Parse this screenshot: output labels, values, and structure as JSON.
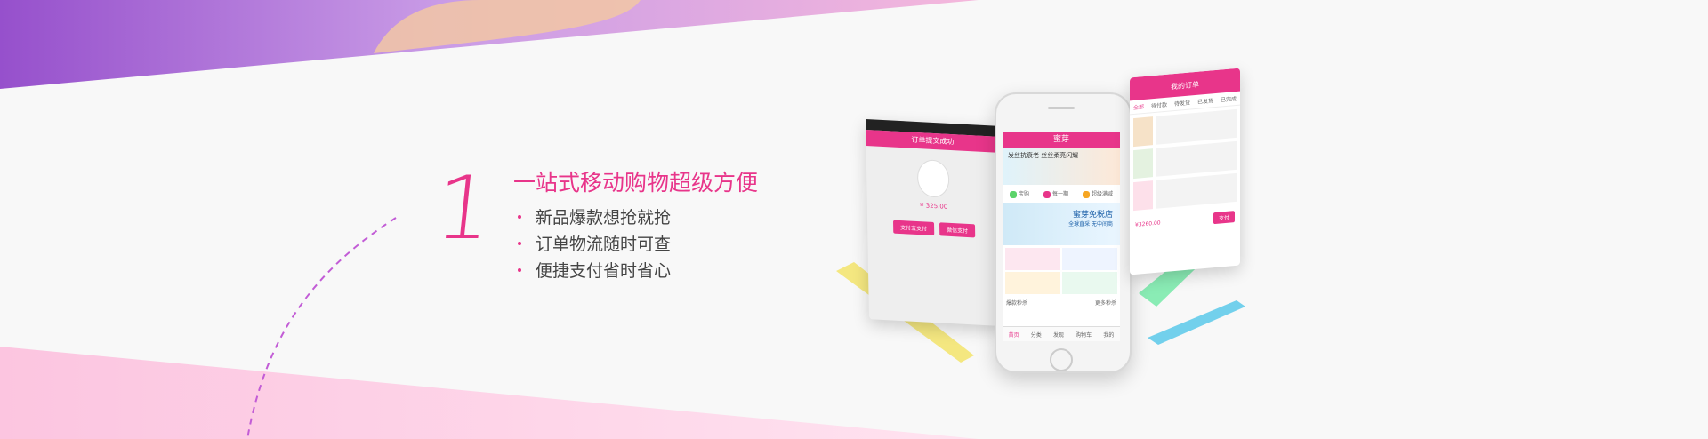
{
  "hero": {
    "number": "1",
    "title": "一站式移动购物超级方便",
    "features": [
      "新品爆款想抢就抢",
      "订单物流随时可查",
      "便捷支付省时省心"
    ]
  },
  "left_phone": {
    "header": "订单提交成功",
    "amount": "¥ 325.00",
    "button_pay": "支付宝支付",
    "button_wechat": "微信支付"
  },
  "center_phone": {
    "app_title": "蜜芽",
    "banner_text": "发丝抗衰老 丝丝柔亮闪耀",
    "icons": [
      "宝购",
      "每一期",
      "超级满减"
    ],
    "promo_title": "蜜芽免税店",
    "promo_sub": "全球直采 无中间商",
    "section_label": "爆款秒杀",
    "section_more": "更多秒杀",
    "tabs": [
      "首页",
      "分类",
      "发现",
      "购物车",
      "我的"
    ]
  },
  "right_phone": {
    "header": "我的订单",
    "tabs": [
      "全部",
      "待付款",
      "待发货",
      "已发货",
      "已完成"
    ],
    "total": "¥3260.00",
    "pay": "支付"
  },
  "colors": {
    "accent": "#e8358a",
    "purple": "#9a4fd0",
    "pink_light": "#fdd3e6"
  }
}
